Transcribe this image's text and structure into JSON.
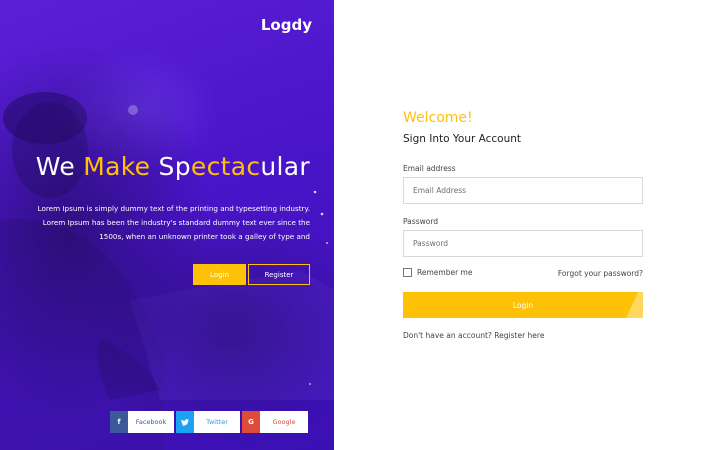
{
  "brand": "Logdy",
  "hero": {
    "title_part1": "We ",
    "title_part2": "Make",
    "title_part3": " Sp",
    "title_part4": "ectac",
    "title_part5": "ular",
    "description": "Lorem Ipsum is simply dummy text of the printing and typesetting industry. Lorem Ipsum has been the industry's standard dummy text ever since the 1500s, when an unknown printer took a galley of type and",
    "login_label": "Login",
    "register_label": "Register"
  },
  "social": {
    "facebook_label": "Facebook",
    "facebook_icon": "f",
    "twitter_label": "Twitter",
    "twitter_icon": "t",
    "google_label": "Google",
    "google_icon": "G"
  },
  "form": {
    "welcome": "Welcome!",
    "subtitle": "Sign Into Your Account",
    "email_label": "Email address",
    "email_placeholder": "Email Address",
    "password_label": "Password",
    "password_placeholder": "Password",
    "remember_label": "Remember me",
    "forgot_label": "Forgot your password?",
    "login_label": "Login",
    "no_account_text": "Don't have an account?",
    "register_link": "Register here"
  },
  "colors": {
    "accent": "#ffc107",
    "panel": "#4a14c9",
    "facebook": "#3b5998",
    "twitter": "#1da1f2",
    "google": "#dd4b39"
  }
}
